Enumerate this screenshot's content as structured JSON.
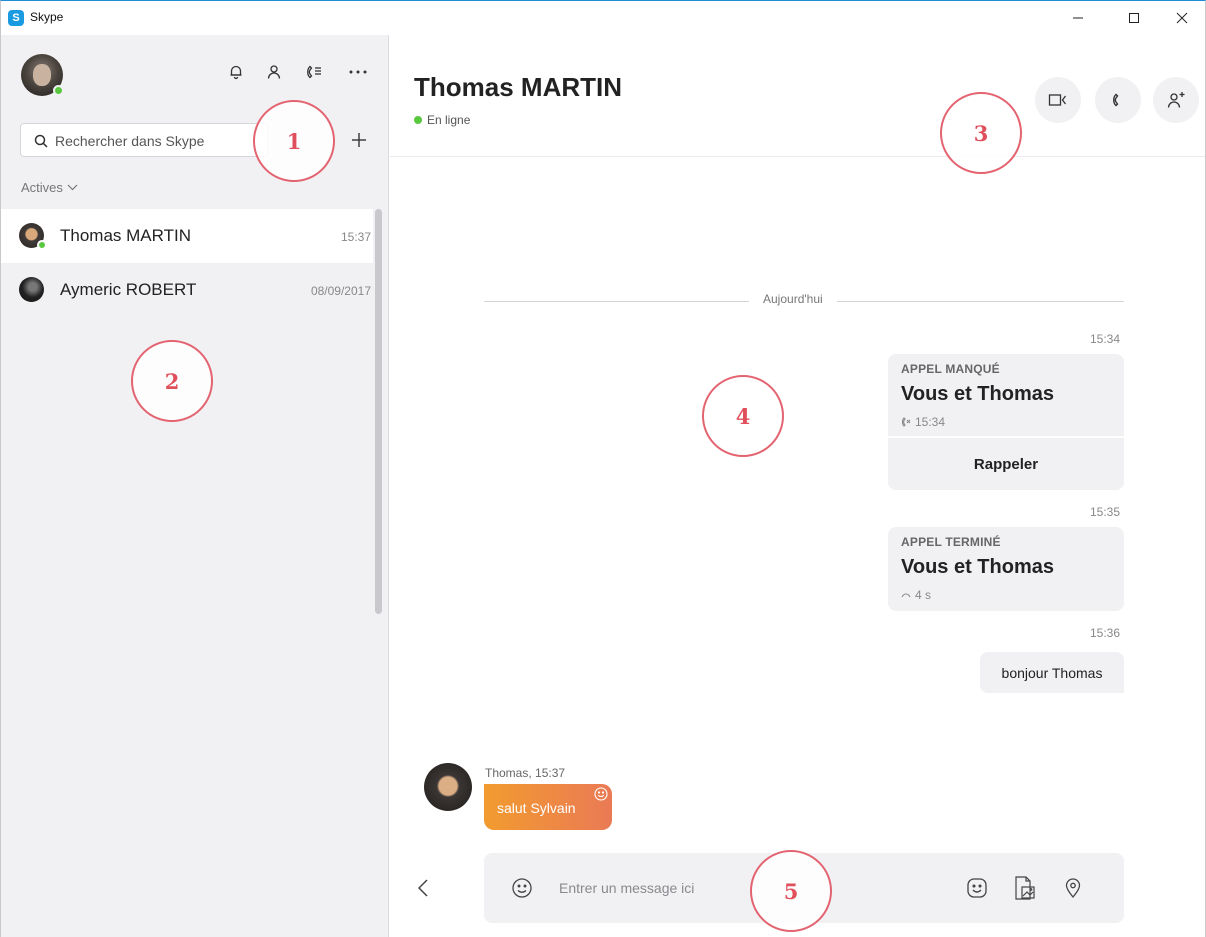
{
  "window": {
    "app_logo": "S",
    "title": "Skype"
  },
  "sidebar": {
    "search_placeholder": "Rechercher dans Skype",
    "filter_label": "Actives",
    "conversations": [
      {
        "name": "Thomas MARTIN",
        "time": "15:37",
        "online": true,
        "active": true
      },
      {
        "name": "Aymeric ROBERT",
        "time": "08/09/2017",
        "online": false,
        "active": false
      }
    ]
  },
  "header": {
    "contact_name": "Thomas MARTIN",
    "status": "En ligne"
  },
  "messages": {
    "day_separator": "Aujourd'hui",
    "call1": {
      "time": "15:34",
      "label": "APPEL MANQUÉ",
      "who": "Vous et Thomas",
      "meta": "15:34",
      "action": "Rappeler"
    },
    "call2": {
      "time": "15:35",
      "label": "APPEL TERMINÉ",
      "who": "Vous et Thomas",
      "meta": "4 s"
    },
    "outgoing": {
      "time": "15:36",
      "text": "bonjour Thomas"
    },
    "incoming": {
      "meta": "Thomas, 15:37",
      "text": "salut Sylvain"
    }
  },
  "composer": {
    "placeholder": "Entrer un message ici"
  },
  "callouts": [
    "1",
    "2",
    "3",
    "4",
    "5"
  ],
  "colors": {
    "accent": "#1a9ae0",
    "online": "#5ac83f",
    "callout": "#e0505c",
    "bubble_in_start": "#f29b2f",
    "bubble_in_end": "#ea7a55"
  }
}
